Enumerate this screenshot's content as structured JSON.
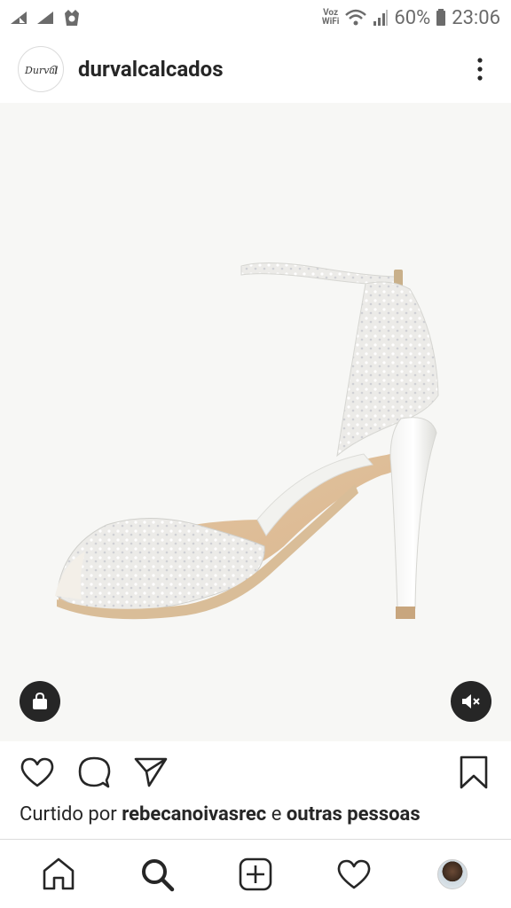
{
  "status_bar": {
    "voz_line1": "Voz",
    "voz_line2": "WiFi",
    "battery": "60%",
    "time": "23:06"
  },
  "post": {
    "username": "durvalcalcados",
    "avatar_text": "Durval",
    "likes_prefix": "Curtido por ",
    "likes_user": "rebecanoivasrec",
    "likes_mid": " e ",
    "likes_others": "outras pessoas"
  },
  "colors": {
    "text": "#262626",
    "image_bg": "#f7f7f5",
    "divider": "#dbdbdb"
  }
}
